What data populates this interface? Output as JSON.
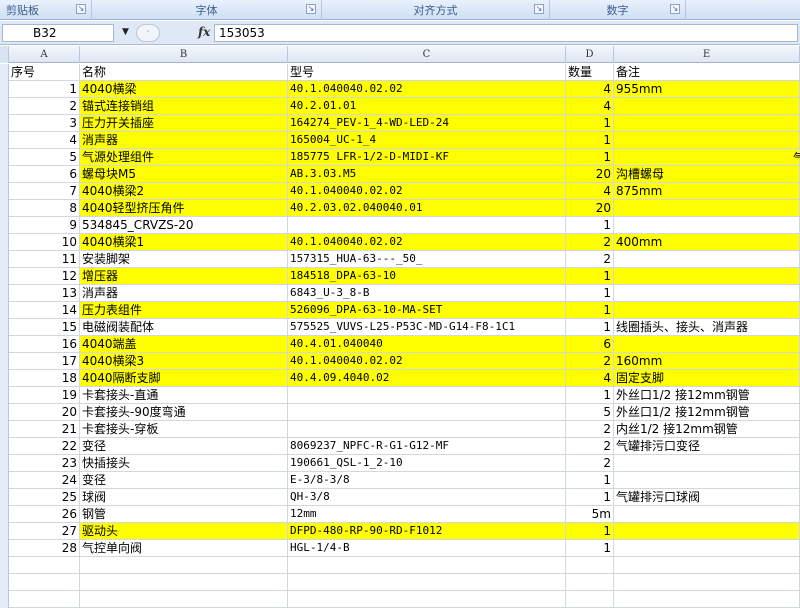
{
  "ribbon": {
    "groups": [
      "剪贴板",
      "字体",
      "对齐方式",
      "数字"
    ]
  },
  "formula_bar": {
    "name_box": "B32",
    "fx_label": "fx",
    "formula": "153053"
  },
  "columns": [
    "A",
    "B",
    "C",
    "D",
    "E"
  ],
  "header_row": {
    "a": "序号",
    "b": "名称",
    "c": "型号",
    "d": "数量",
    "e": "备注"
  },
  "rows": [
    {
      "a": "1",
      "b": "4040横梁",
      "c": "40.1.040040.02.02",
      "d": "4",
      "e": "955mm",
      "hl": true
    },
    {
      "a": "2",
      "b": "锚式连接销组",
      "c": "40.2.01.01",
      "d": "4",
      "e": "",
      "hl": true
    },
    {
      "a": "3",
      "b": "压力开关插座",
      "c": "164274_PEV-1_4-WD-LED-24",
      "d": "1",
      "e": "",
      "hl": true
    },
    {
      "a": "4",
      "b": "消声器",
      "c": "165004_UC-1_4",
      "d": "1",
      "e": "",
      "hl": true
    },
    {
      "a": "5",
      "b": "气源处理组件",
      "c": "185775 LFR-1/2-D-MIDI-KF",
      "d": "1",
      "e": "",
      "hl": true
    },
    {
      "a": "6",
      "b": "螺母块M5",
      "c": "AB.3.03.M5",
      "d": "20",
      "e": "沟槽螺母",
      "hl": true
    },
    {
      "a": "7",
      "b": "4040横梁2",
      "c": "40.1.040040.02.02",
      "d": "4",
      "e": "875mm",
      "hl": true
    },
    {
      "a": "8",
      "b": "4040轻型挤压角件",
      "c": "40.2.03.02.040040.01",
      "d": "20",
      "e": "",
      "hl": true
    },
    {
      "a": "9",
      "b": "534845_CRVZS-20",
      "c": "",
      "d": "1",
      "e": "",
      "hl": false
    },
    {
      "a": "10",
      "b": "4040横梁1",
      "c": "40.1.040040.02.02",
      "d": "2",
      "e": "400mm",
      "hl": true
    },
    {
      "a": "11",
      "b": "安装脚架",
      "c": "157315_HUA-63---_50_",
      "d": "2",
      "e": "",
      "hl": false
    },
    {
      "a": "12",
      "b": "增压器",
      "c": "184518_DPA-63-10",
      "d": "1",
      "e": "",
      "hl": true
    },
    {
      "a": "13",
      "b": "消声器",
      "c": "6843_U-3_8-B",
      "d": "1",
      "e": "",
      "hl": false
    },
    {
      "a": "14",
      "b": "压力表组件",
      "c": "526096_DPA-63-10-MA-SET",
      "d": "1",
      "e": "",
      "hl": true
    },
    {
      "a": "15",
      "b": "电磁阀装配体",
      "c": "575525_VUVS-L25-P53C-MD-G14-F8-1C1",
      "d": "1",
      "e": "线圈插头、接头、消声器",
      "hl": false
    },
    {
      "a": "16",
      "b": "4040端盖",
      "c": "40.4.01.040040",
      "d": "6",
      "e": "",
      "hl": true
    },
    {
      "a": "17",
      "b": "4040横梁3",
      "c": "40.1.040040.02.02",
      "d": "2",
      "e": "160mm",
      "hl": true
    },
    {
      "a": "18",
      "b": "4040隔断支脚",
      "c": "40.4.09.4040.02",
      "d": "4",
      "e": "固定支脚",
      "hl": true
    },
    {
      "a": "19",
      "b": "卡套接头-直通",
      "c": "",
      "d": "1",
      "e": "外丝口1/2  接12mm钢管",
      "hl": false
    },
    {
      "a": "20",
      "b": "卡套接头-90度弯通",
      "c": "",
      "d": "5",
      "e": "外丝口1/2  接12mm钢管",
      "hl": false
    },
    {
      "a": "21",
      "b": "卡套接头-穿板",
      "c": "",
      "d": "2",
      "e": "内丝1/2   接12mm钢管",
      "hl": false
    },
    {
      "a": "22",
      "b": "变径",
      "c": "8069237_NPFC-R-G1-G12-MF",
      "d": "2",
      "e": "气罐排污口变径",
      "hl": false
    },
    {
      "a": "23",
      "b": "快插接头",
      "c": "190661_QSL-1_2-10",
      "d": "2",
      "e": "",
      "hl": false
    },
    {
      "a": "24",
      "b": "变径",
      "c": "E-3/8-3/8",
      "d": "1",
      "e": "",
      "hl": false
    },
    {
      "a": "25",
      "b": "球阀",
      "c": "QH-3/8",
      "d": "1",
      "e": "气罐排污口球阀",
      "hl": false
    },
    {
      "a": "26",
      "b": "钢管",
      "c": "12mm",
      "d": "5m",
      "e": "",
      "hl": false
    },
    {
      "a": "27",
      "b": "驱动头",
      "c": "DFPD-480-RP-90-RD-F1012",
      "d": "1",
      "e": "",
      "hl": true
    },
    {
      "a": "28",
      "b": "气控单向阀",
      "c": "HGL-1/4-B",
      "d": "1",
      "e": "",
      "hl": false
    }
  ],
  "overflow_char": "气",
  "colors": {
    "highlight": "#ffff00",
    "gridline": "#d0d7e5"
  }
}
